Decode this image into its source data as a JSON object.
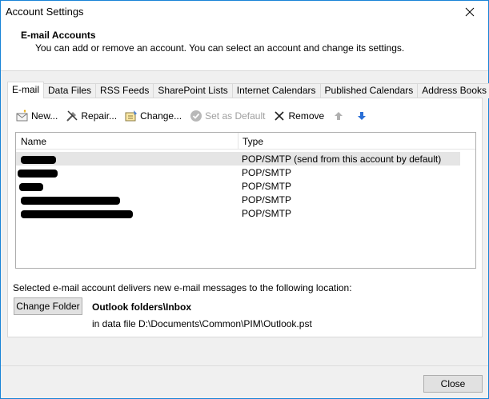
{
  "window": {
    "title": "Account Settings"
  },
  "header": {
    "title": "E-mail Accounts",
    "subtitle": "You can add or remove an account. You can select an account and change its settings."
  },
  "tabs": [
    {
      "label": "E-mail",
      "active": true
    },
    {
      "label": "Data Files",
      "active": false
    },
    {
      "label": "RSS Feeds",
      "active": false
    },
    {
      "label": "SharePoint Lists",
      "active": false
    },
    {
      "label": "Internet Calendars",
      "active": false
    },
    {
      "label": "Published Calendars",
      "active": false
    },
    {
      "label": "Address Books",
      "active": false
    }
  ],
  "toolbar": {
    "new_label": "New...",
    "repair_label": "Repair...",
    "change_label": "Change...",
    "set_default_label": "Set as Default",
    "remove_label": "Remove"
  },
  "accounts_list": {
    "col_name": "Name",
    "col_type": "Type",
    "rows": [
      {
        "type": "POP/SMTP (send from this account by default)",
        "selected": true
      },
      {
        "type": "POP/SMTP",
        "selected": false
      },
      {
        "type": "POP/SMTP",
        "selected": false
      },
      {
        "type": "POP/SMTP",
        "selected": false
      },
      {
        "type": "POP/SMTP",
        "selected": false
      }
    ]
  },
  "delivery": {
    "label": "Selected e-mail account delivers new e-mail messages to the following location:",
    "change_folder_label": "Change Folder",
    "folder": "Outlook folders\\Inbox",
    "data_file": "in data file D:\\Documents\\Common\\PIM\\Outlook.pst"
  },
  "footer": {
    "close_label": "Close"
  },
  "colors": {
    "accent": "#1883d7",
    "selected_row": "#e5e5e5",
    "arrow_up_disabled": "#b0b0b0",
    "arrow_down": "#2a6fd6"
  }
}
